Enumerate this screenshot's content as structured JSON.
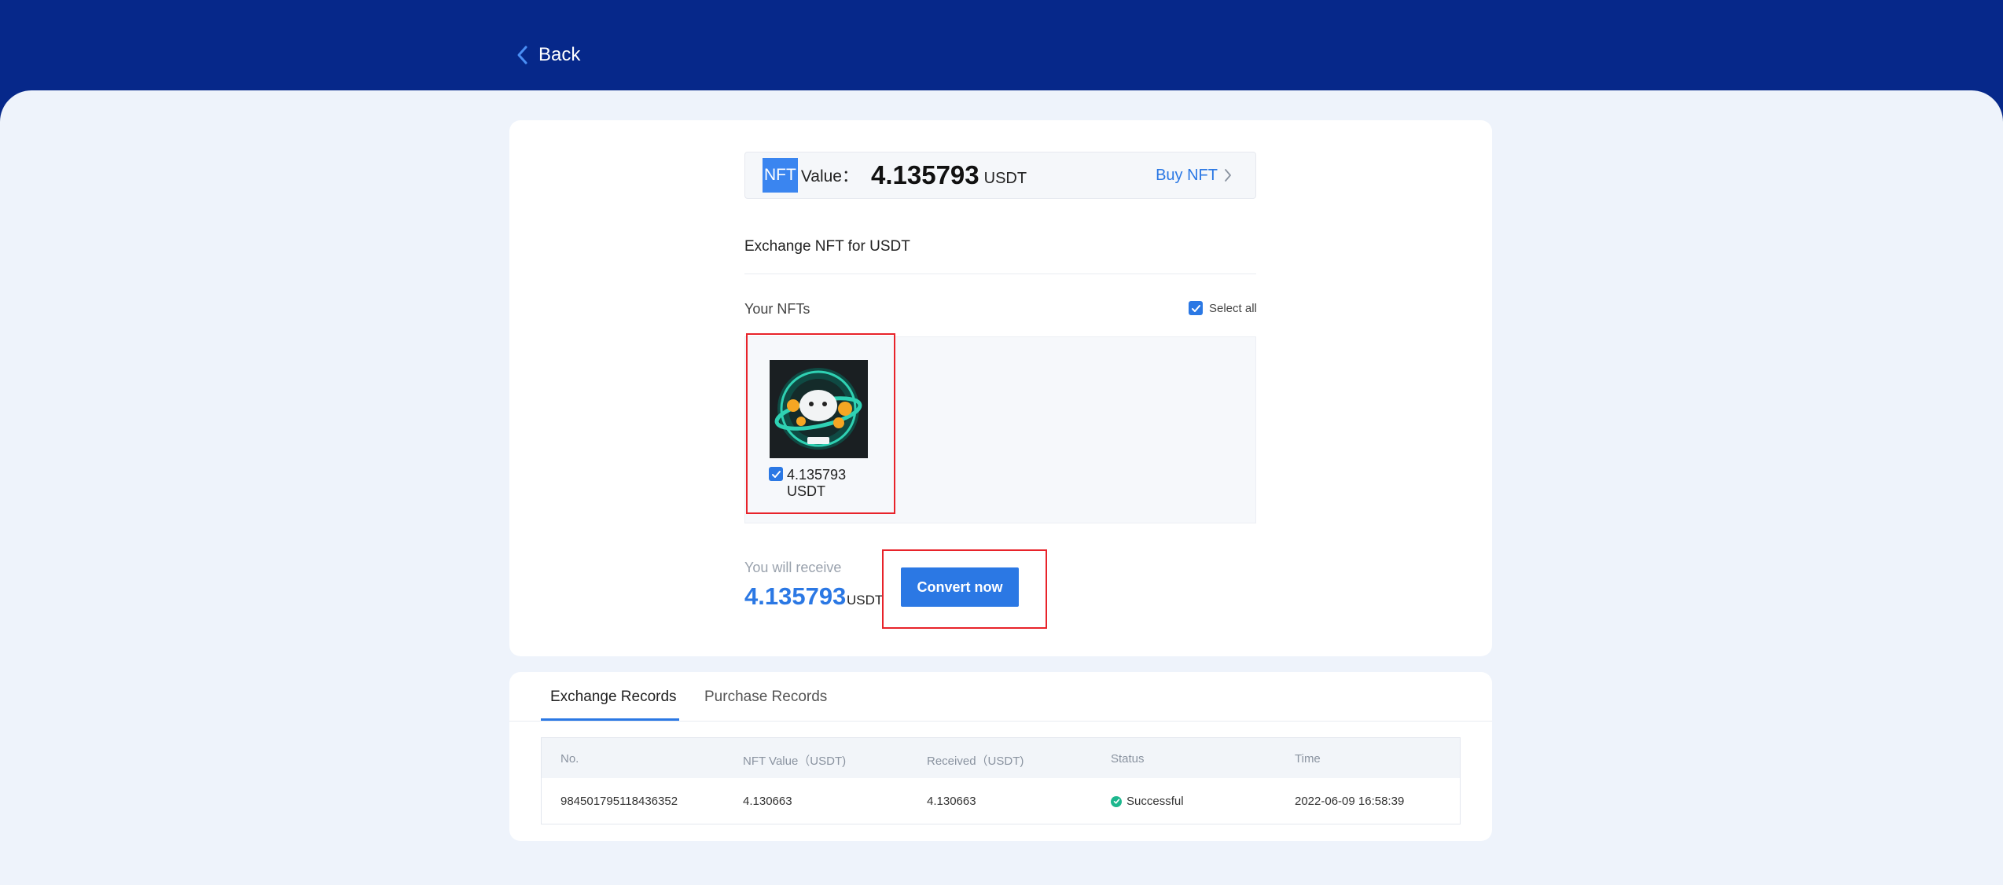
{
  "header": {
    "back_label": "Back"
  },
  "nft_value": {
    "tag": "NFT",
    "label": "Value：",
    "amount": "4.135793",
    "unit": "USDT",
    "buy_link": "Buy NFT"
  },
  "exchange": {
    "title": "Exchange NFT for USDT",
    "your_nfts": "Your NFTs",
    "select_all": "Select all",
    "select_all_checked": true
  },
  "nft_items": [
    {
      "value": "4.135793 USDT",
      "checked": true
    }
  ],
  "receive": {
    "label": "You will receive",
    "amount": "4.135793",
    "unit": "USDT",
    "convert_button": "Convert now"
  },
  "records": {
    "tabs": [
      {
        "label": "Exchange Records",
        "active": true
      },
      {
        "label": "Purchase Records",
        "active": false
      }
    ],
    "columns": [
      "No.",
      "NFT Value（USDT)",
      "Received（USDT)",
      "Status",
      "Time"
    ],
    "rows": [
      {
        "no": "984501795118436352",
        "nft_value": "4.130663",
        "received": "4.130663",
        "status": "Successful",
        "time": "2022-06-09 16:58:39"
      }
    ]
  },
  "colors": {
    "header_bg": "#06288a",
    "accent": "#2b78e4",
    "highlight_border": "#e8232a",
    "success": "#1db78e"
  },
  "icons": [
    "chevron-left-icon",
    "chevron-right-icon",
    "check-icon",
    "success-icon"
  ]
}
